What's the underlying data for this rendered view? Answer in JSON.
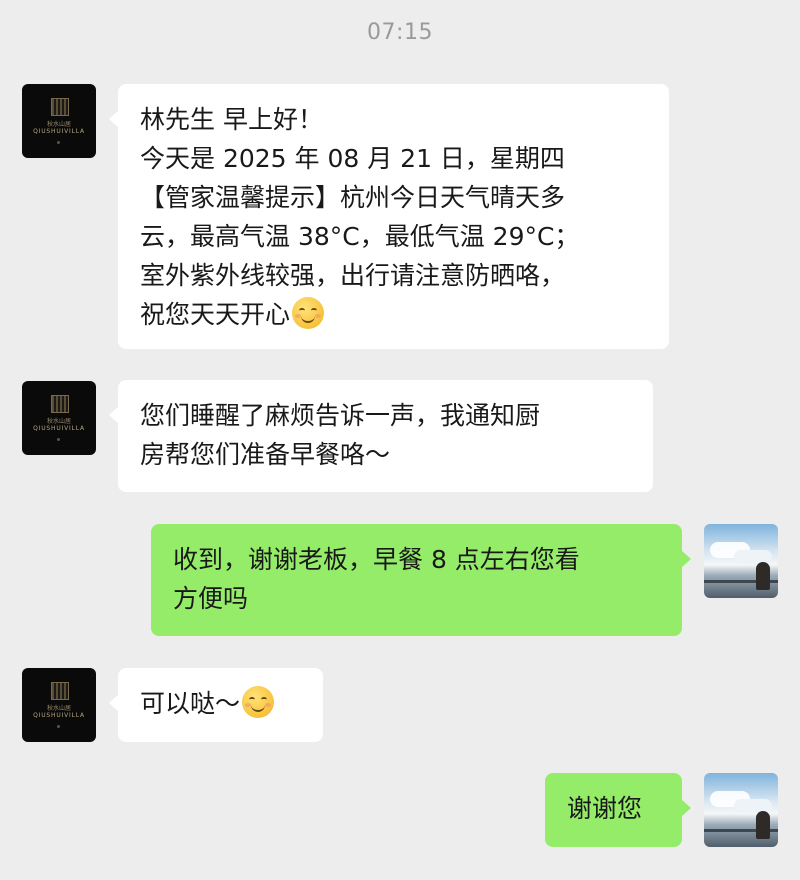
{
  "status": {
    "time": "07:15"
  },
  "contact": {
    "avatar_cn": "秋水山居",
    "avatar_en": "QIUSHUIVILLA"
  },
  "messages": [
    {
      "direction": "in",
      "lines": [
        "林先生 早上好！",
        "今天是 2025 年 08 月 21 日，星期四",
        "【管家温馨提示】杭州今日天气晴天多",
        "云，最高气温 38°C，最低气温 29°C；",
        "室外紫外线较强，出行请注意防晒咯，",
        "祝您天天开心"
      ],
      "emoji": "smiling-face-icon"
    },
    {
      "direction": "in",
      "lines": [
        "您们睡醒了麻烦告诉一声，我通知厨",
        "房帮您们准备早餐咯～"
      ]
    },
    {
      "direction": "out",
      "lines": [
        "收到，谢谢老板，早餐 8 点左右您看",
        "方便吗"
      ]
    },
    {
      "direction": "in",
      "lines": [
        "可以哒～"
      ],
      "emoji": "smiling-face-icon"
    },
    {
      "direction": "out",
      "lines": [
        "谢谢您"
      ]
    }
  ],
  "colors": {
    "background": "#ededed",
    "incoming_bubble": "#ffffff",
    "outgoing_bubble": "#95ec69"
  }
}
